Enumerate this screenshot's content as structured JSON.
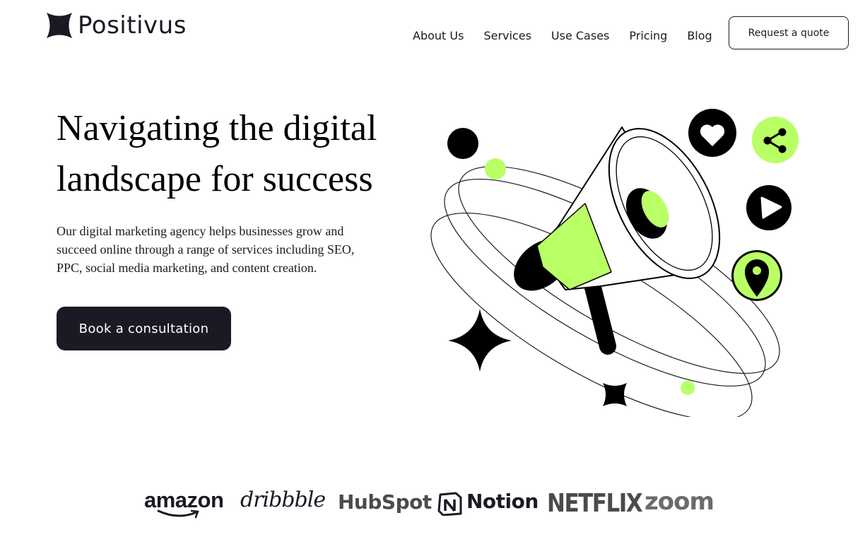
{
  "header": {
    "logo_text": "Positivus",
    "logo_icon": "four-point-star-icon",
    "nav": [
      "About Us",
      "Services",
      "Use Cases",
      "Pricing",
      "Blog"
    ],
    "quote_button": "Request a quote"
  },
  "hero": {
    "title": "Navigating the digital landscape for success",
    "description": "Our digital marketing agency helps businesses grow and succeed online through a range of services including SEO, PPC, social media marketing, and content creation.",
    "cta": "Book a consultation",
    "illustration_icons": [
      "megaphone-icon",
      "heart-icon",
      "share-icon",
      "play-icon",
      "location-pin-icon",
      "sparkle-icon"
    ]
  },
  "clients": [
    "amazon",
    "dribbble",
    "HubSpot",
    "Notion",
    "NETFLIX",
    "zoom"
  ],
  "colors": {
    "accent": "#b9ff66",
    "dark": "#191a23",
    "background": "#ffffff"
  }
}
